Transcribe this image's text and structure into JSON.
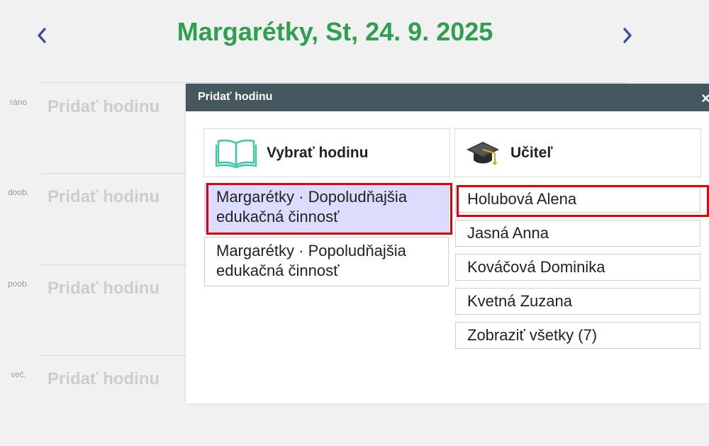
{
  "header": {
    "title": "Margarétky, St, 24. 9. 2025"
  },
  "slots": [
    {
      "label": "ráno",
      "add_label": "Pridať hodinu"
    },
    {
      "label": "doob.",
      "add_label": "Pridať hodinu"
    },
    {
      "label": "poob.",
      "add_label": "Pridať hodinu"
    },
    {
      "label": "več.",
      "add_label": "Pridať hodinu"
    }
  ],
  "modal": {
    "title": "Pridať hodinu",
    "close_glyph": "×",
    "lesson_column": {
      "header": "Vybrať hodinu",
      "items": [
        {
          "class_name": "Margarétky",
          "separator": "·",
          "activity": "Dopoludňajšia edukačná činnosť"
        },
        {
          "class_name": "Margarétky",
          "separator": "·",
          "activity": "Popoludňajšia edukačná činnosť"
        }
      ]
    },
    "teacher_column": {
      "header": "Učiteľ",
      "items": [
        "Holubová Alena",
        "Jasná Anna",
        "Kováčová Dominika",
        "Kvetná Zuzana",
        "Zobraziť všetky (7)"
      ]
    }
  },
  "colors": {
    "title_green": "#2ea04f",
    "modal_header": "#45585f",
    "selected_item_bg": "#dcdcfc",
    "highlight_red": "#e4000a",
    "icon_teal": "#3cc7a4"
  },
  "icons": {
    "prev": "chevron-left-icon",
    "next": "chevron-right-icon",
    "lesson": "book-icon",
    "teacher": "graduation-cap-icon"
  }
}
